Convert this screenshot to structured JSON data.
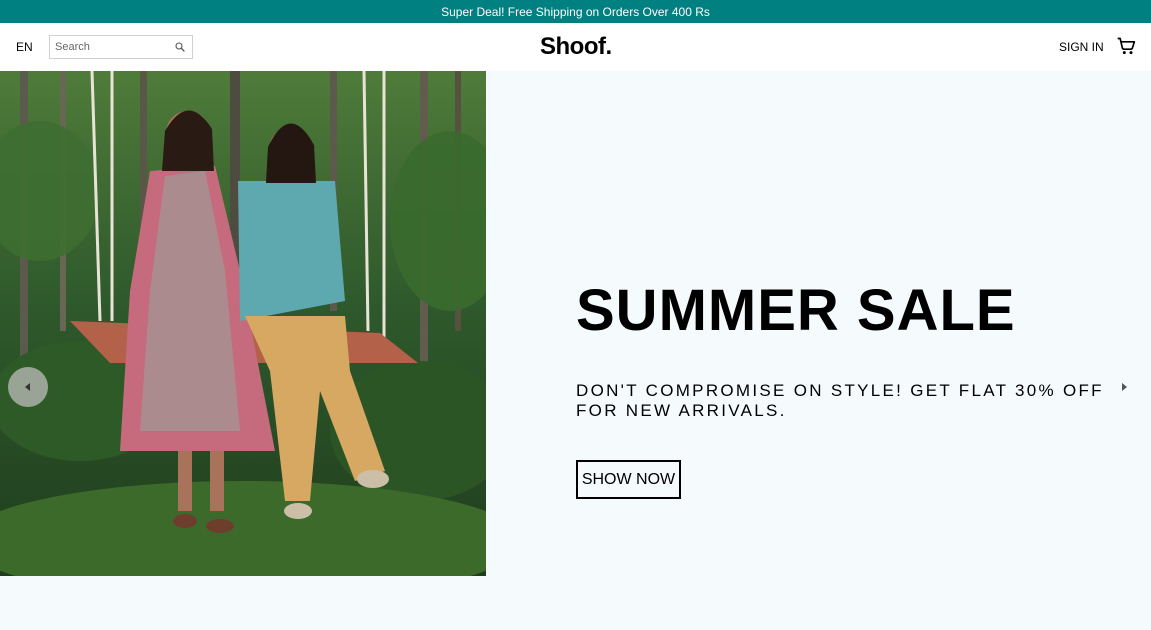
{
  "announcement": {
    "text": "Super Deal! Free Shipping on Orders Over 400 Rs"
  },
  "header": {
    "language": "EN",
    "search_placeholder": "Search",
    "logo": "Shoof.",
    "sign_in": "SIGN IN",
    "icons": {
      "search": "search-icon",
      "cart": "shopping-cart-icon"
    }
  },
  "hero": {
    "title": "SUMMER SALE",
    "subtitle": "DON'T COMPROMISE ON STYLE! GET FLAT 30% OFF FOR NEW ARRIVALS.",
    "cta_label": "SHOW NOW",
    "icons": {
      "prev": "chevron-left-icon",
      "next": "chevron-right-icon"
    }
  },
  "colors": {
    "announcement_bg": "#008080",
    "page_bg": "#f5fafd",
    "text": "#000000"
  }
}
